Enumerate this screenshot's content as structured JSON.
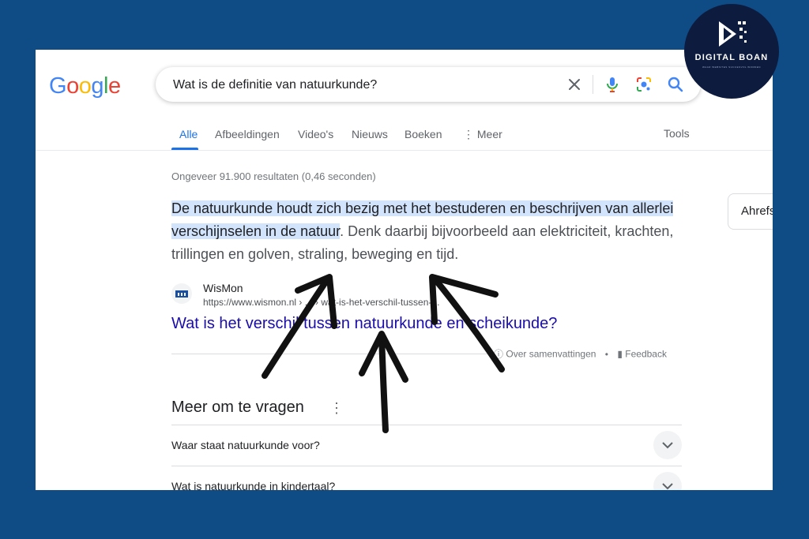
{
  "search": {
    "query": "Wat is de definitie van natuurkunde?",
    "logo_text": "Google"
  },
  "tabs": [
    "Alle",
    "Afbeeldingen",
    "Video's",
    "Nieuws",
    "Boeken",
    "Meer"
  ],
  "tools_label": "Tools",
  "stats": "Ongeveer 91.900 resultaten (0,46 seconden)",
  "snippet": {
    "highlight": "De natuurkunde houdt zich bezig met het bestuderen en beschrijven van allerlei verschijnselen in de natuur",
    "rest": ". Denk daarbij bijvoorbeeld aan elektriciteit, krachten, trillingen en golven, straling, beweging en tijd."
  },
  "source": {
    "name": "WisMon",
    "url": "https://www.wismon.nl › ... › wat-is-het-verschil-tussen-...",
    "title": "Wat is het verschil tussen natuurkunde en scheikunde?"
  },
  "feedback_row": {
    "about_label": "Over samenvattingen",
    "separator": "•",
    "feedback_label": "Feedback"
  },
  "paa": {
    "title": "Meer om te vragen",
    "questions": [
      "Waar staat natuurkunde voor?",
      "Wat is natuurkunde in kindertaal?"
    ]
  },
  "side_card": {
    "label": "Ahrefs"
  },
  "badge": {
    "brand": "DIGITAL BOAN",
    "tagline": "WAAR WEBSITES SUCCESVOL WORDEN"
  },
  "colors": {
    "page_bg": "#0f4c85",
    "highlight": "#d2e3fc",
    "link": "#1a0dab",
    "accent": "#1a73e8"
  }
}
